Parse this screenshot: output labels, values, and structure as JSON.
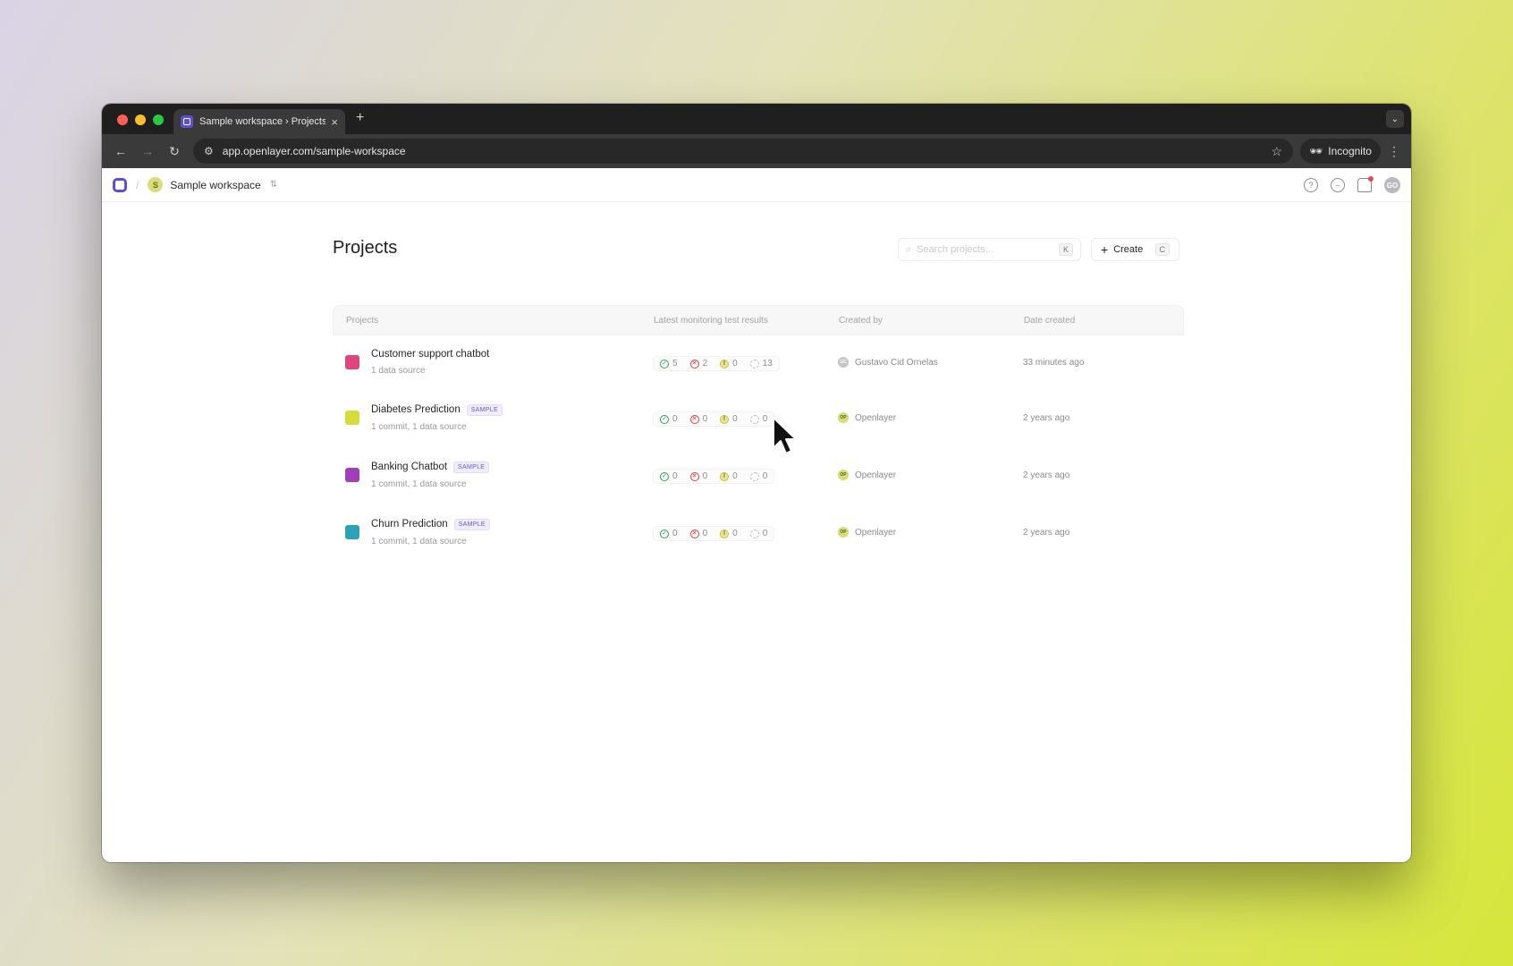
{
  "browser": {
    "tab_title": "Sample workspace › Projects",
    "tab_close": "×",
    "new_tab": "+",
    "url": "app.openlayer.com/sample-workspace",
    "incognito_label": "Incognito"
  },
  "header": {
    "workspace_initial": "S",
    "workspace_name": "Sample workspace",
    "user_initials": "GO"
  },
  "page": {
    "title": "Projects",
    "search_placeholder": "Search projects...",
    "search_shortcut": "K",
    "create_label": "Create",
    "create_shortcut": "C"
  },
  "table": {
    "columns": [
      "Projects",
      "Latest monitoring test results",
      "Created by",
      "Date created"
    ],
    "rows": [
      {
        "name": "Customer support chatbot",
        "badge": "",
        "subtitle": "1 data source",
        "icon_color": "#e0457b",
        "results": {
          "passing": "5",
          "failing": "2",
          "warning": "0",
          "skipped": "13"
        },
        "creator_initials": "GC",
        "creator": "Gustavo Cid Ornelas",
        "date": "33 minutes ago"
      },
      {
        "name": "Diabetes Prediction",
        "badge": "SAMPLE",
        "subtitle": "1 commit, 1 data source",
        "icon_color": "#d6dc3a",
        "results": {
          "passing": "0",
          "failing": "0",
          "warning": "0",
          "skipped": "0"
        },
        "creator_initials": "OP",
        "creator": "Openlayer",
        "date": "2 years ago"
      },
      {
        "name": "Banking Chatbot",
        "badge": "SAMPLE",
        "subtitle": "1 commit, 1 data source",
        "icon_color": "#a13fb8",
        "results": {
          "passing": "0",
          "failing": "0",
          "warning": "0",
          "skipped": "0"
        },
        "creator_initials": "OP",
        "creator": "Openlayer",
        "date": "2 years ago"
      },
      {
        "name": "Churn Prediction",
        "badge": "SAMPLE",
        "subtitle": "1 commit, 1 data source",
        "icon_color": "#2aa3b8",
        "results": {
          "passing": "0",
          "failing": "0",
          "warning": "0",
          "skipped": "0"
        },
        "creator_initials": "OP",
        "creator": "Openlayer",
        "date": "2 years ago"
      }
    ]
  },
  "colors": {
    "accent": "#5b4fd6",
    "pass": "#2e9b6b",
    "fail": "#d8403c",
    "warn": "#c9c43a"
  }
}
